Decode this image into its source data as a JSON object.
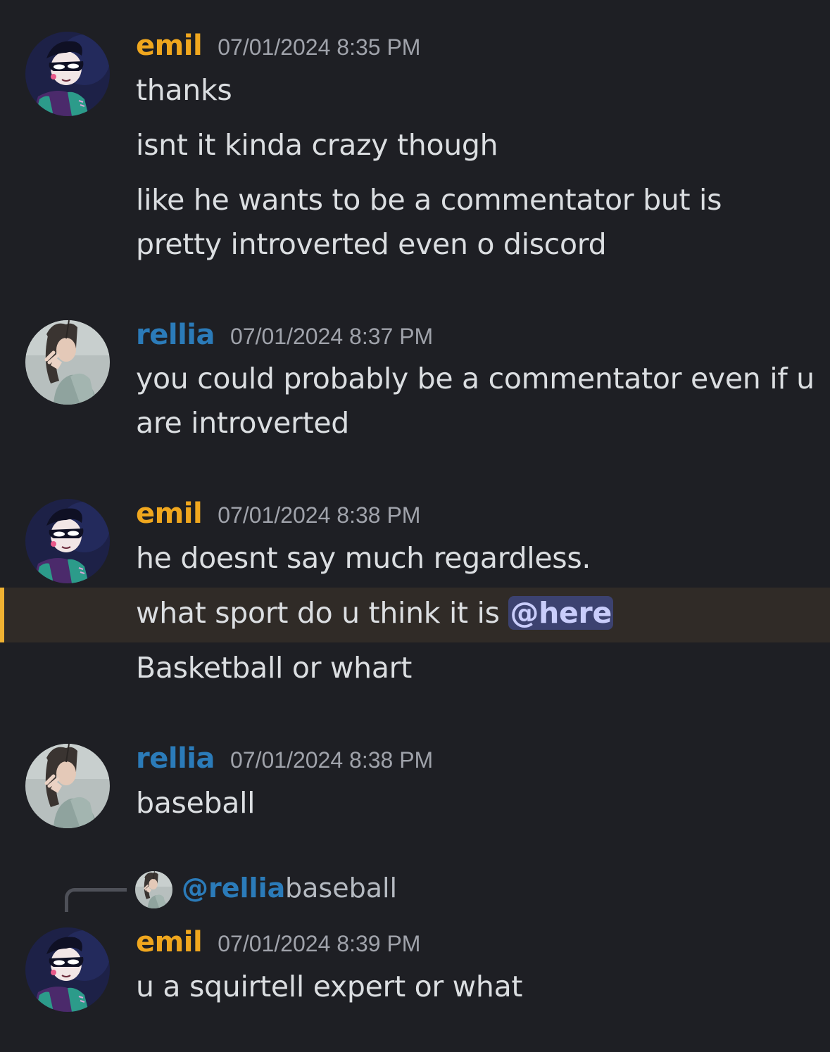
{
  "colors": {
    "background": "#1e1f24",
    "emil_name": "#f0a71e",
    "rellia_name": "#2b7bb9",
    "timestamp": "#a0a3ab",
    "message_text": "#dbdee1",
    "mention_bg": "#3c4270",
    "mention_text": "#c9cdfb",
    "highlight_bg": "#302b27",
    "highlight_bar": "#f0b232"
  },
  "messages": [
    {
      "author": "emil",
      "timestamp": "07/01/2024 8:35 PM",
      "avatar_icon": "masked-hero-avatar",
      "lines": [
        "thanks",
        "isnt it kinda crazy though",
        "like he wants to be a commentator but is",
        "pretty introverted even o discord"
      ]
    },
    {
      "author": "rellia",
      "timestamp": "07/01/2024 8:37 PM",
      "avatar_icon": "photo-avatar",
      "lines": [
        "you could probably be a commentator even if u",
        "are introverted"
      ]
    },
    {
      "author": "emil",
      "timestamp": "07/01/2024 8:38 PM",
      "avatar_icon": "masked-hero-avatar",
      "lines": [
        "he doesnt say much regardless.",
        "what sport do u think it is ",
        "Basketball or whart"
      ],
      "mention": "@here"
    },
    {
      "author": "rellia",
      "timestamp": "07/01/2024 8:38 PM",
      "avatar_icon": "photo-avatar",
      "lines": [
        "baseball"
      ]
    },
    {
      "author": "emil",
      "timestamp": "07/01/2024 8:39 PM",
      "avatar_icon": "masked-hero-avatar",
      "reply": {
        "author": "@rellia",
        "text": "baseball"
      },
      "lines": [
        "u a squirtell expert or what"
      ]
    }
  ]
}
